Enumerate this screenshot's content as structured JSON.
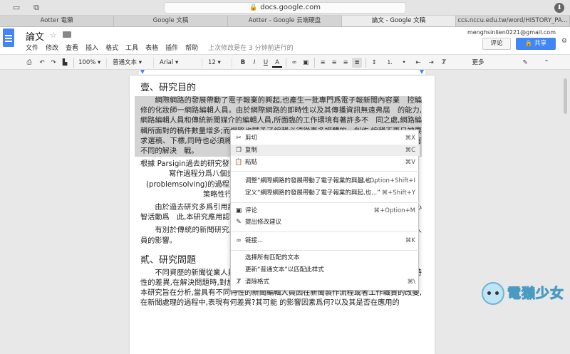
{
  "browser": {
    "url": "docs.google.com",
    "tabs": [
      {
        "label": "Aotter 電獺"
      },
      {
        "label": "Google 文稿"
      },
      {
        "label": "Aotter - Google 云端硬盘"
      },
      {
        "label": "論文 - Google 文稿",
        "active": true
      },
      {
        "label": "ccs.nccu.edu.tw/word/HISTORY_PA..."
      }
    ]
  },
  "docs": {
    "title": "論文",
    "menus": [
      "文件",
      "修改",
      "查看",
      "插入",
      "格式",
      "工具",
      "表格",
      "插件",
      "帮助"
    ],
    "last_edit": "上次修改是在 3 分钟前进行的",
    "account": "menghsinlien0221@gmail.com",
    "comment_label": "评论",
    "share_label": "共享"
  },
  "toolbar": {
    "zoom": "100%",
    "style": "普通文本",
    "font": "Arial",
    "size": "12",
    "bold": "B",
    "italic": "I",
    "underline": "U",
    "text_color": "A",
    "more": "更多"
  },
  "document": {
    "heading1": "壹、研究目的",
    "paragraphs": [
      "網際網路的發展帶動了電子報業的興起,也產生一批專門爲電子報新聞內容業　控編修的化妝師一網路編輯人員。由於網際網路的即時性以及其傳播資訊無遠弗屆　的能力,網路編輯人員和傳統新聞媒介的編輯人員,所面臨的工作環境有著許多不　同之處,網路編輯所面對的稿件數量增多;而網路也賦予了編輯必須從事多媒體的　創作,編輯不再只被要求選稿、下標,同時也必須將新聞作更　予了更多的附加價值。因此,　編輯人員,必須有不同的解決　戰。",
      "根據 Parsigin過去的研究發　新聞從業人員會以一定的過程",
      "寫作過程分爲八個步驟",
      "(problemsolving)的過程,如",
      "策略性行爲,",
      "由於過去研究多爲引用認知　深入人類的心智精構中,以了解　理新聞資訊,以及其心智活動爲　此,本研究應用認知心理學理論　及傳統媒介的新聞編輯 人員在",
      "有別於傳統的新聞研究,本　(think　aloud)的方式,研究新聞　控制,對新聞編輯人員的影響。"
    ],
    "heading2": "貳、研究問題",
    "paragraph_last": "不同資歷的新聞從業人員,由於具備的先前知識與工作經驗的差異,以及所屬　媒介特性的差異,在解決問題時,對於問題表徵的建立與解決方案的執行上可能會 有不同表現。本研究旨在分析,當具有不同特性的新聞編輯人員因在新聞製作流程或者工作職責的改變,在新聞處理的過程中,表現有何差異?其可能 的影響因素爲何?以及其是否在應用的"
  },
  "context_menu": {
    "items": [
      {
        "icon": "scissors-icon",
        "glyph": "✂",
        "label": "剪切",
        "shortcut": "⌘X"
      },
      {
        "icon": "copy-icon",
        "glyph": "❐",
        "label": "复制",
        "shortcut": "⌘C",
        "highlight": true
      },
      {
        "icon": "paste-icon",
        "glyph": "📋",
        "label": "粘贴",
        "shortcut": "⌘V"
      },
      {
        "icon": "",
        "glyph": "",
        "label": "调整“網際網路的發展帶動了電子報業的興起,也...",
        "shortcut": "⌘+Option+Shift+I"
      },
      {
        "icon": "",
        "glyph": "",
        "label": "定义“網際網路的發展帶動了電子報業的興起,也...”",
        "shortcut": "⌘+Shift+Y"
      },
      {
        "icon": "comment-icon",
        "glyph": "▣",
        "label": "评论",
        "shortcut": "⌘+Option+M"
      },
      {
        "icon": "suggest-edit-icon",
        "glyph": "✎",
        "label": "提出修改建议",
        "shortcut": ""
      },
      {
        "icon": "link-icon",
        "glyph": "∞",
        "label": "链接...",
        "shortcut": "⌘K"
      },
      {
        "icon": "",
        "glyph": "",
        "label": "选择所有匹配的文本",
        "shortcut": ""
      },
      {
        "icon": "",
        "glyph": "",
        "label": "更新“普通文本”以匹配此样式",
        "shortcut": ""
      },
      {
        "icon": "clear-format-icon",
        "glyph": "Ⱦ",
        "label": "清除格式",
        "shortcut": "⌘\\"
      }
    ]
  },
  "watermark": {
    "text": "電獺少女"
  }
}
